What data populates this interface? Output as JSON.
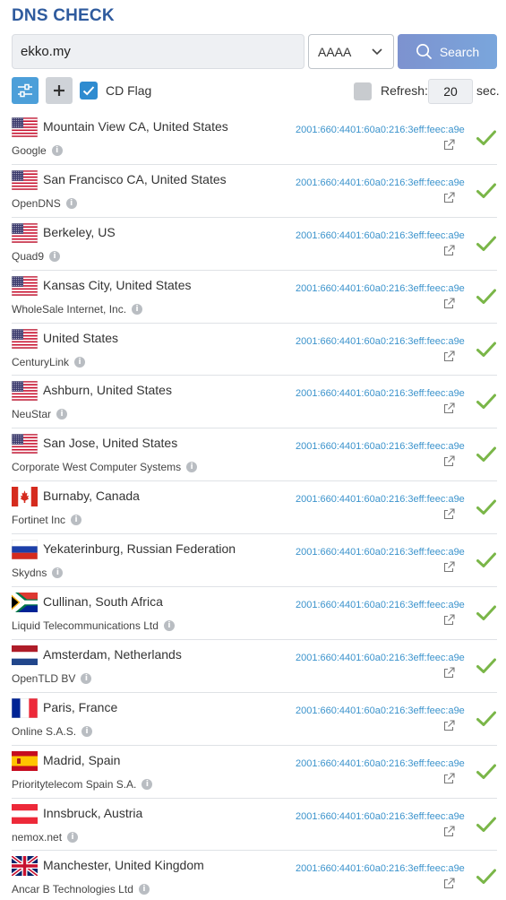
{
  "app": {
    "title": "DNS CHECK"
  },
  "search": {
    "domain_value": "ekko.my",
    "record_type": "AAAA",
    "search_label": "Search"
  },
  "options": {
    "cd_flag_label": "CD Flag",
    "cd_flag_checked": true,
    "refresh_label": "Refresh:",
    "refresh_checked": false,
    "refresh_value": "20",
    "refresh_unit": "sec."
  },
  "colors": {
    "title": "#2f5b9e",
    "accent": "#4c9fd9",
    "ip_link": "#3b93cc",
    "success": "#7ab648"
  },
  "results": [
    {
      "flag": "us",
      "location": "Mountain View CA, United States",
      "provider": "Google",
      "ip": "2001:660:4401:60a0:216:3eff:feec:a9e",
      "status": "ok"
    },
    {
      "flag": "us",
      "location": "San Francisco CA, United States",
      "provider": "OpenDNS",
      "ip": "2001:660:4401:60a0:216:3eff:feec:a9e",
      "status": "ok"
    },
    {
      "flag": "us",
      "location": "Berkeley, US",
      "provider": "Quad9",
      "ip": "2001:660:4401:60a0:216:3eff:feec:a9e",
      "status": "ok"
    },
    {
      "flag": "us",
      "location": "Kansas City, United States",
      "provider": "WholeSale Internet, Inc.",
      "ip": "2001:660:4401:60a0:216:3eff:feec:a9e",
      "status": "ok"
    },
    {
      "flag": "us",
      "location": "United States",
      "provider": "CenturyLink",
      "ip": "2001:660:4401:60a0:216:3eff:feec:a9e",
      "status": "ok"
    },
    {
      "flag": "us",
      "location": "Ashburn, United States",
      "provider": "NeuStar",
      "ip": "2001:660:4401:60a0:216:3eff:feec:a9e",
      "status": "ok"
    },
    {
      "flag": "us",
      "location": "San Jose, United States",
      "provider": "Corporate West Computer Systems",
      "ip": "2001:660:4401:60a0:216:3eff:feec:a9e",
      "status": "ok"
    },
    {
      "flag": "ca",
      "location": "Burnaby, Canada",
      "provider": "Fortinet Inc",
      "ip": "2001:660:4401:60a0:216:3eff:feec:a9e",
      "status": "ok"
    },
    {
      "flag": "ru",
      "location": "Yekaterinburg, Russian Federation",
      "provider": "Skydns",
      "ip": "2001:660:4401:60a0:216:3eff:feec:a9e",
      "status": "ok"
    },
    {
      "flag": "za",
      "location": "Cullinan, South Africa",
      "provider": "Liquid Telecommunications Ltd",
      "ip": "2001:660:4401:60a0:216:3eff:feec:a9e",
      "status": "ok"
    },
    {
      "flag": "nl",
      "location": "Amsterdam, Netherlands",
      "provider": "OpenTLD BV",
      "ip": "2001:660:4401:60a0:216:3eff:feec:a9e",
      "status": "ok"
    },
    {
      "flag": "fr",
      "location": "Paris, France",
      "provider": "Online S.A.S.",
      "ip": "2001:660:4401:60a0:216:3eff:feec:a9e",
      "status": "ok"
    },
    {
      "flag": "es",
      "location": "Madrid, Spain",
      "provider": "Prioritytelecom Spain S.A.",
      "ip": "2001:660:4401:60a0:216:3eff:feec:a9e",
      "status": "ok"
    },
    {
      "flag": "at",
      "location": "Innsbruck, Austria",
      "provider": "nemox.net",
      "ip": "2001:660:4401:60a0:216:3eff:feec:a9e",
      "status": "ok"
    },
    {
      "flag": "gb",
      "location": "Manchester, United Kingdom",
      "provider": "Ancar B Technologies Ltd",
      "ip": "2001:660:4401:60a0:216:3eff:feec:a9e",
      "status": "ok"
    }
  ]
}
